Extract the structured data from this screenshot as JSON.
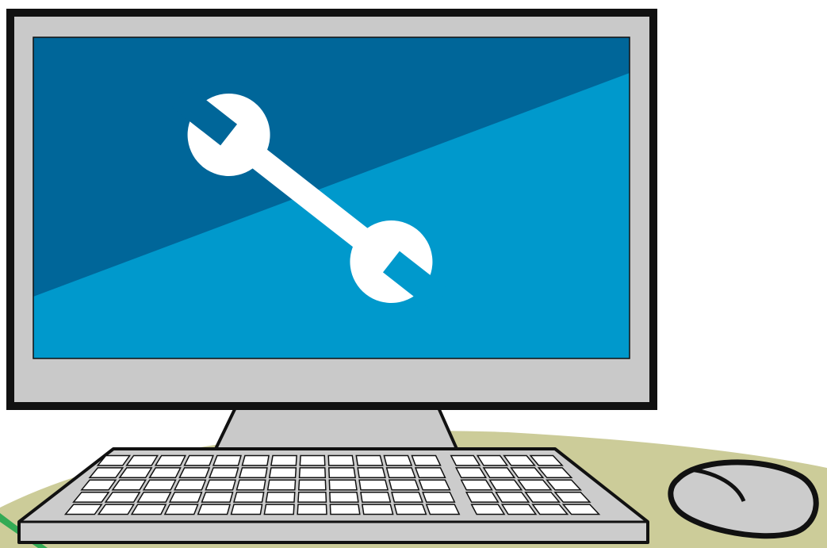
{
  "illustration": {
    "subject": "desktop-computer-with-wrench-on-screen",
    "icons": {
      "screen_icon": "wrench-icon",
      "input_devices": [
        "keyboard-icon",
        "mouse-icon"
      ]
    }
  },
  "colors": {
    "outline": "#111111",
    "monitor_bezel": "#c9c9c9",
    "screen_dark_blue": "#006699",
    "screen_light_blue": "#0099cc",
    "wrench": "#ffffff",
    "desk_surface": "#cccc99",
    "desk_edge_accent": "#33aa55",
    "keyboard_body": "#cccccc",
    "keyboard_keys": "#ffffff",
    "mouse_body": "#cccccc"
  }
}
